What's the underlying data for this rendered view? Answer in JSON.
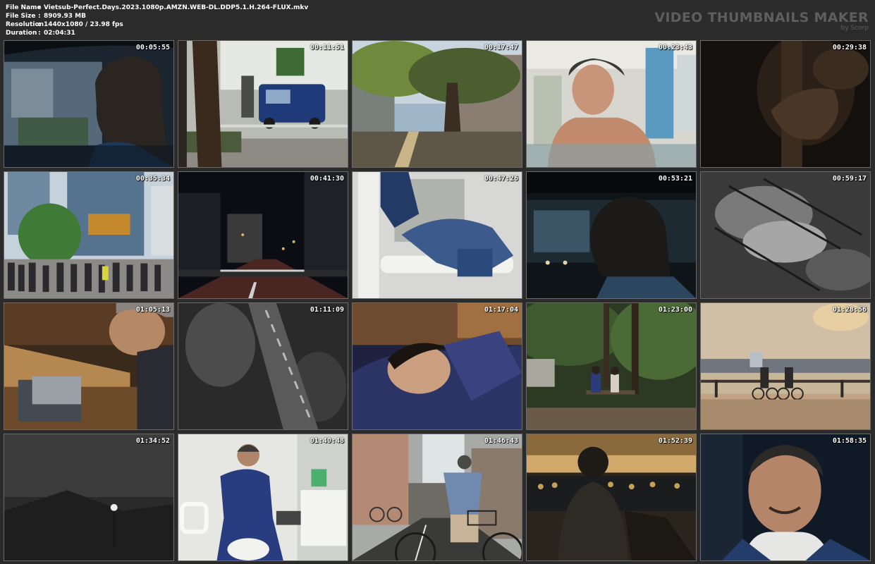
{
  "file_info": [
    {
      "label": "File Name",
      "value": "Vietsub-Perfect.Days.2023.1080p.AMZN.WEB-DL.DDP5.1.H.264-FLUX.mkv"
    },
    {
      "label": "File Size",
      "value": "8909.93 MB"
    },
    {
      "label": "Resolution",
      "value": "1440x1080 / 23.98 fps"
    },
    {
      "label": "Duration",
      "value": "02:04:31"
    }
  ],
  "separator": ":",
  "brand": {
    "title": "VIDEO THUMBNAILS MAKER",
    "subtitle": "by Scorp"
  },
  "thumbnails": [
    {
      "timestamp": "00:05:55",
      "scene": "driver-profile-car"
    },
    {
      "timestamp": "00:11:51",
      "scene": "street-tree-van"
    },
    {
      "timestamp": "00:17:47",
      "scene": "park-trees-sunlight"
    },
    {
      "timestamp": "00:23:43",
      "scene": "man-in-bath"
    },
    {
      "timestamp": "00:29:38",
      "scene": "dark-hand-glass"
    },
    {
      "timestamp": "00:35:34",
      "scene": "shibuya-crowd"
    },
    {
      "timestamp": "00:41:30",
      "scene": "night-street"
    },
    {
      "timestamp": "00:47:26",
      "scene": "cleaning-toilet-rail"
    },
    {
      "timestamp": "00:53:21",
      "scene": "man-driving-night"
    },
    {
      "timestamp": "00:59:17",
      "scene": "bw-abstract-leaves"
    },
    {
      "timestamp": "01:05:13",
      "scene": "man-tin-box"
    },
    {
      "timestamp": "01:11:09",
      "scene": "bw-abstract-road"
    },
    {
      "timestamp": "01:17:04",
      "scene": "woman-lying-smile"
    },
    {
      "timestamp": "01:23:00",
      "scene": "couple-bench-shrine"
    },
    {
      "timestamp": "01:28:56",
      "scene": "riverside-cyclists"
    },
    {
      "timestamp": "01:34:52",
      "scene": "bw-dark-light"
    },
    {
      "timestamp": "01:40:48",
      "scene": "worker-toilet-smile"
    },
    {
      "timestamp": "01:46:43",
      "scene": "man-cycling-alley"
    },
    {
      "timestamp": "01:52:39",
      "scene": "man-river-bokeh"
    },
    {
      "timestamp": "01:58:35",
      "scene": "man-smiling-closeup"
    }
  ]
}
